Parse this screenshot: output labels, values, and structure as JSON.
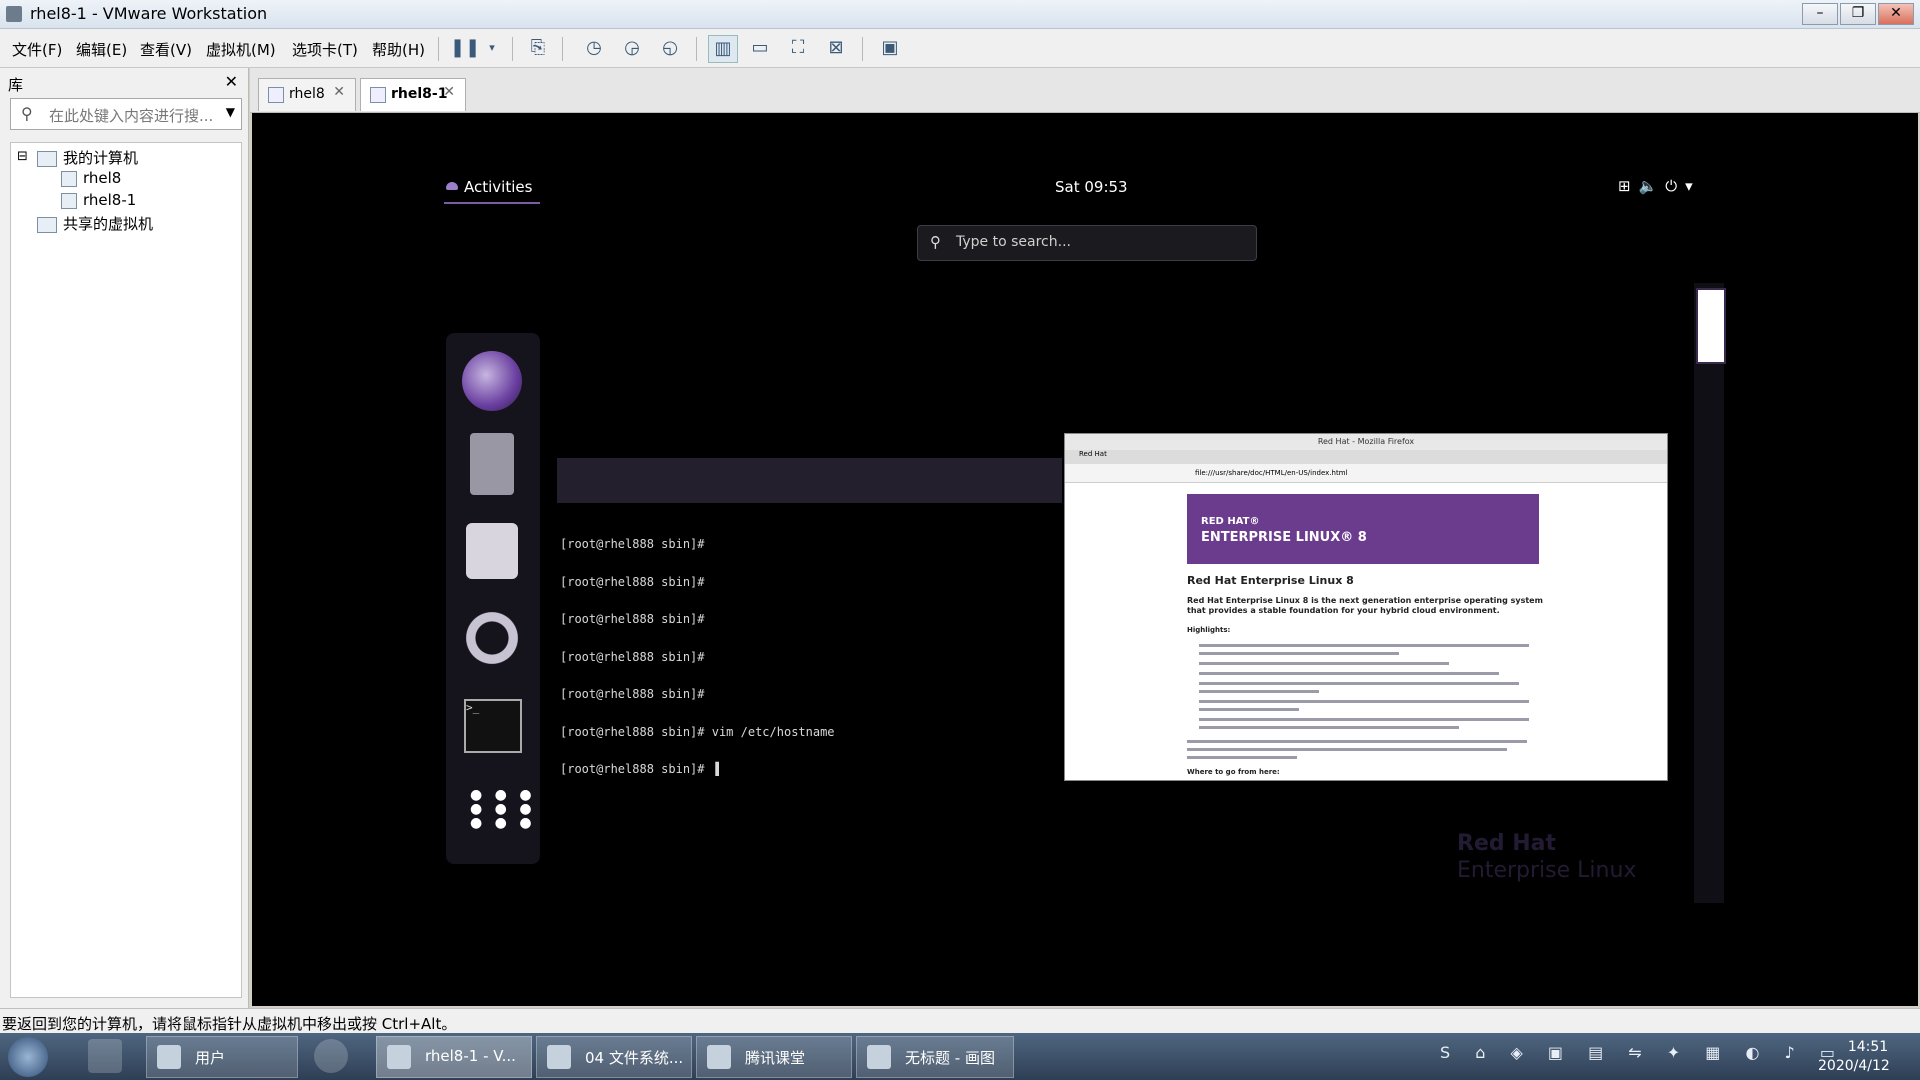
{
  "window": {
    "title": "rhel8-1 - VMware Workstation",
    "minimize": "–",
    "restore": "❐",
    "close": "✕"
  },
  "menu": {
    "file": "文件(F)",
    "edit": "编辑(E)",
    "view": "查看(V)",
    "vm": "虚拟机(M)",
    "tabs": "选项卡(T)",
    "help": "帮助(H)"
  },
  "toolbar": {
    "icons": [
      "pause-icon",
      "send-ctrl-alt-del-icon",
      "snapshot-icon",
      "revert-snapshot-icon",
      "snapshot-manager-icon",
      "library-view-icon",
      "thumbnail-bar-icon",
      "full-screen-icon",
      "unity-icon",
      "console-view-icon"
    ]
  },
  "library": {
    "header": "库",
    "close": "✕",
    "search_placeholder": "在此处键入内容进行搜...",
    "tree": {
      "my_computer": "我的计算机",
      "vm1": "rhel8",
      "vm2": "rhel8-1",
      "shared": "共享的虚拟机",
      "collapse": "⊟"
    }
  },
  "tabs": [
    {
      "label": "rhel8",
      "close": "✕"
    },
    {
      "label": "rhel8-1",
      "close": "✕"
    }
  ],
  "vm": {
    "activities": "Activities",
    "clock": "Sat 09:53",
    "tray": "⊞🔈⏻▾",
    "search_placeholder": "Type to search...",
    "terminal_lines": [
      "[root@rhel888 sbin]#",
      "[root@rhel888 sbin]#",
      "[root@rhel888 sbin]#",
      "[root@rhel888 sbin]#",
      "[root@rhel888 sbin]#",
      "[root@rhel888 sbin]# vim /etc/hostname",
      "[root@rhel888 sbin]# ▐"
    ],
    "terminal_icon_text": ">_",
    "apps_grid": "● ● ●\n● ● ●\n● ● ●",
    "firefox": {
      "title": "Red Hat - Mozilla Firefox",
      "tab": "Red Hat",
      "url": "file:///usr/share/doc/HTML/en-US/index.html",
      "banner_line1": "RED HAT®",
      "banner_line2": "ENTERPRISE LINUX® 8",
      "heading": "Red Hat Enterprise Linux 8",
      "intro": "Red Hat Enterprise Linux 8 is the next generation enterprise operating system that provides a stable foundation for your hybrid cloud environment.",
      "highlights": "Highlights:",
      "where": "Where to go from here:"
    },
    "wallpaper_logo_line1": "Red Hat",
    "wallpaper_logo_line2": "Enterprise Linux"
  },
  "status": {
    "message": "要返回到您的计算机，请将鼠标指针从虚拟机中移出或按 Ctrl+Alt。"
  },
  "taskbar": {
    "buttons": [
      {
        "label": "用户"
      },
      {
        "label": "rhel8-1 - V..."
      },
      {
        "label": "04 文件系统..."
      },
      {
        "label": "腾讯课堂"
      },
      {
        "label": "无标题 - 画图"
      }
    ],
    "tray": "S ⌂ ◈ ▣ ▤ ⇋ ✦ ▦ ◐ ♪ ▭",
    "time": "14:51",
    "date": "2020/4/12"
  }
}
